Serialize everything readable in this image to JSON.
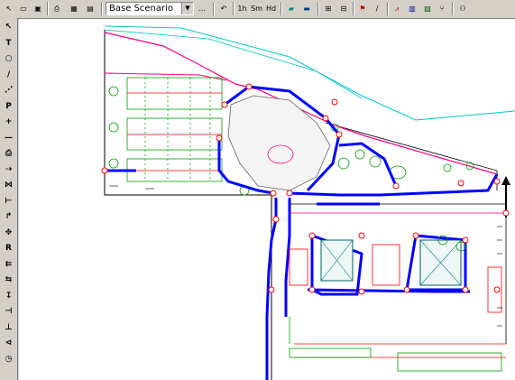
{
  "toolbar": {
    "scenario": {
      "selected": "Base Scenario",
      "ellipsis": "..."
    },
    "time_buttons": [
      "1h",
      "Sm",
      "Hd"
    ]
  },
  "side_tools": [
    {
      "icon": "pointer-icon",
      "glyph": "↖"
    },
    {
      "icon": "text-tool-icon",
      "glyph": "T"
    },
    {
      "icon": "circle-tool-icon",
      "glyph": "○"
    },
    {
      "icon": "line-tool-icon",
      "glyph": "/"
    },
    {
      "icon": "dashed-line-icon",
      "glyph": "⋰"
    },
    {
      "icon": "parking-icon",
      "glyph": "P"
    },
    {
      "icon": "add-node-icon",
      "glyph": "+"
    },
    {
      "icon": "remove-link-icon",
      "glyph": "—"
    },
    {
      "icon": "printer-icon",
      "glyph": "⎙"
    },
    {
      "icon": "route-tool-icon",
      "glyph": "⇢"
    },
    {
      "icon": "split-tool-icon",
      "glyph": "⋈"
    },
    {
      "icon": "merge-tool-icon",
      "glyph": "⊢"
    },
    {
      "icon": "turn-tool-icon",
      "glyph": "↱"
    },
    {
      "icon": "move-tool-icon",
      "glyph": "✥"
    },
    {
      "icon": "route-r-icon",
      "glyph": "R"
    },
    {
      "icon": "lane-tool-icon",
      "glyph": "⇇"
    },
    {
      "icon": "signal-tool-icon",
      "glyph": "⇆"
    },
    {
      "icon": "measure-tool-icon",
      "glyph": "↧"
    },
    {
      "icon": "junction-tool-icon",
      "glyph": "⊣"
    },
    {
      "icon": "stop-tool-icon",
      "glyph": "⊥"
    },
    {
      "icon": "priority-tool-icon",
      "glyph": "⊲"
    },
    {
      "icon": "clock-icon",
      "glyph": "◷"
    }
  ],
  "colors": {
    "links": "#0000ff",
    "nodes": "#ff0000",
    "magenta": "#ff0080",
    "green": "#00a000",
    "cyan": "#00c8c8",
    "dark": "#000000"
  }
}
